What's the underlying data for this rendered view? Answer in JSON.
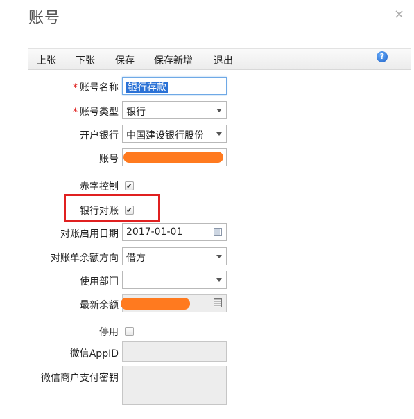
{
  "dialog": {
    "title": "账号",
    "close_glyph": "×"
  },
  "toolbar": {
    "prev_label": "上张",
    "next_label": "下张",
    "save_label": "保存",
    "save_new_label": "保存新增",
    "exit_label": "退出",
    "help_icon": "?"
  },
  "form": {
    "required_mark": "*",
    "account_name_label": "账号名称",
    "account_name_value": "银行存款",
    "account_type_label": "账号类型",
    "account_type_value": "银行",
    "bank_label": "开户银行",
    "bank_value": "中国建设银行股份",
    "account_no_label": "账号",
    "red_control_label": "赤字控制",
    "red_control_checked": true,
    "reconcile_label": "银行对账",
    "reconcile_checked": true,
    "reconcile_start_label": "对账启用日期",
    "reconcile_start_value": "2017-01-01",
    "balance_direction_label": "对账单余额方向",
    "balance_direction_value": "借方",
    "department_label": "使用部门",
    "department_value": "",
    "latest_balance_label": "最新余额",
    "disabled_label": "停用",
    "disabled_checked": false,
    "wechat_appid_label": "微信AppID",
    "wechat_appid_value": "",
    "wechat_key_label": "微信商户支付密钥",
    "wechat_key_value": ""
  },
  "colors": {
    "required": "#e0201e",
    "highlight_box": "#e02020",
    "redaction": "#ff7a1f",
    "selection": "#2b72d6"
  }
}
